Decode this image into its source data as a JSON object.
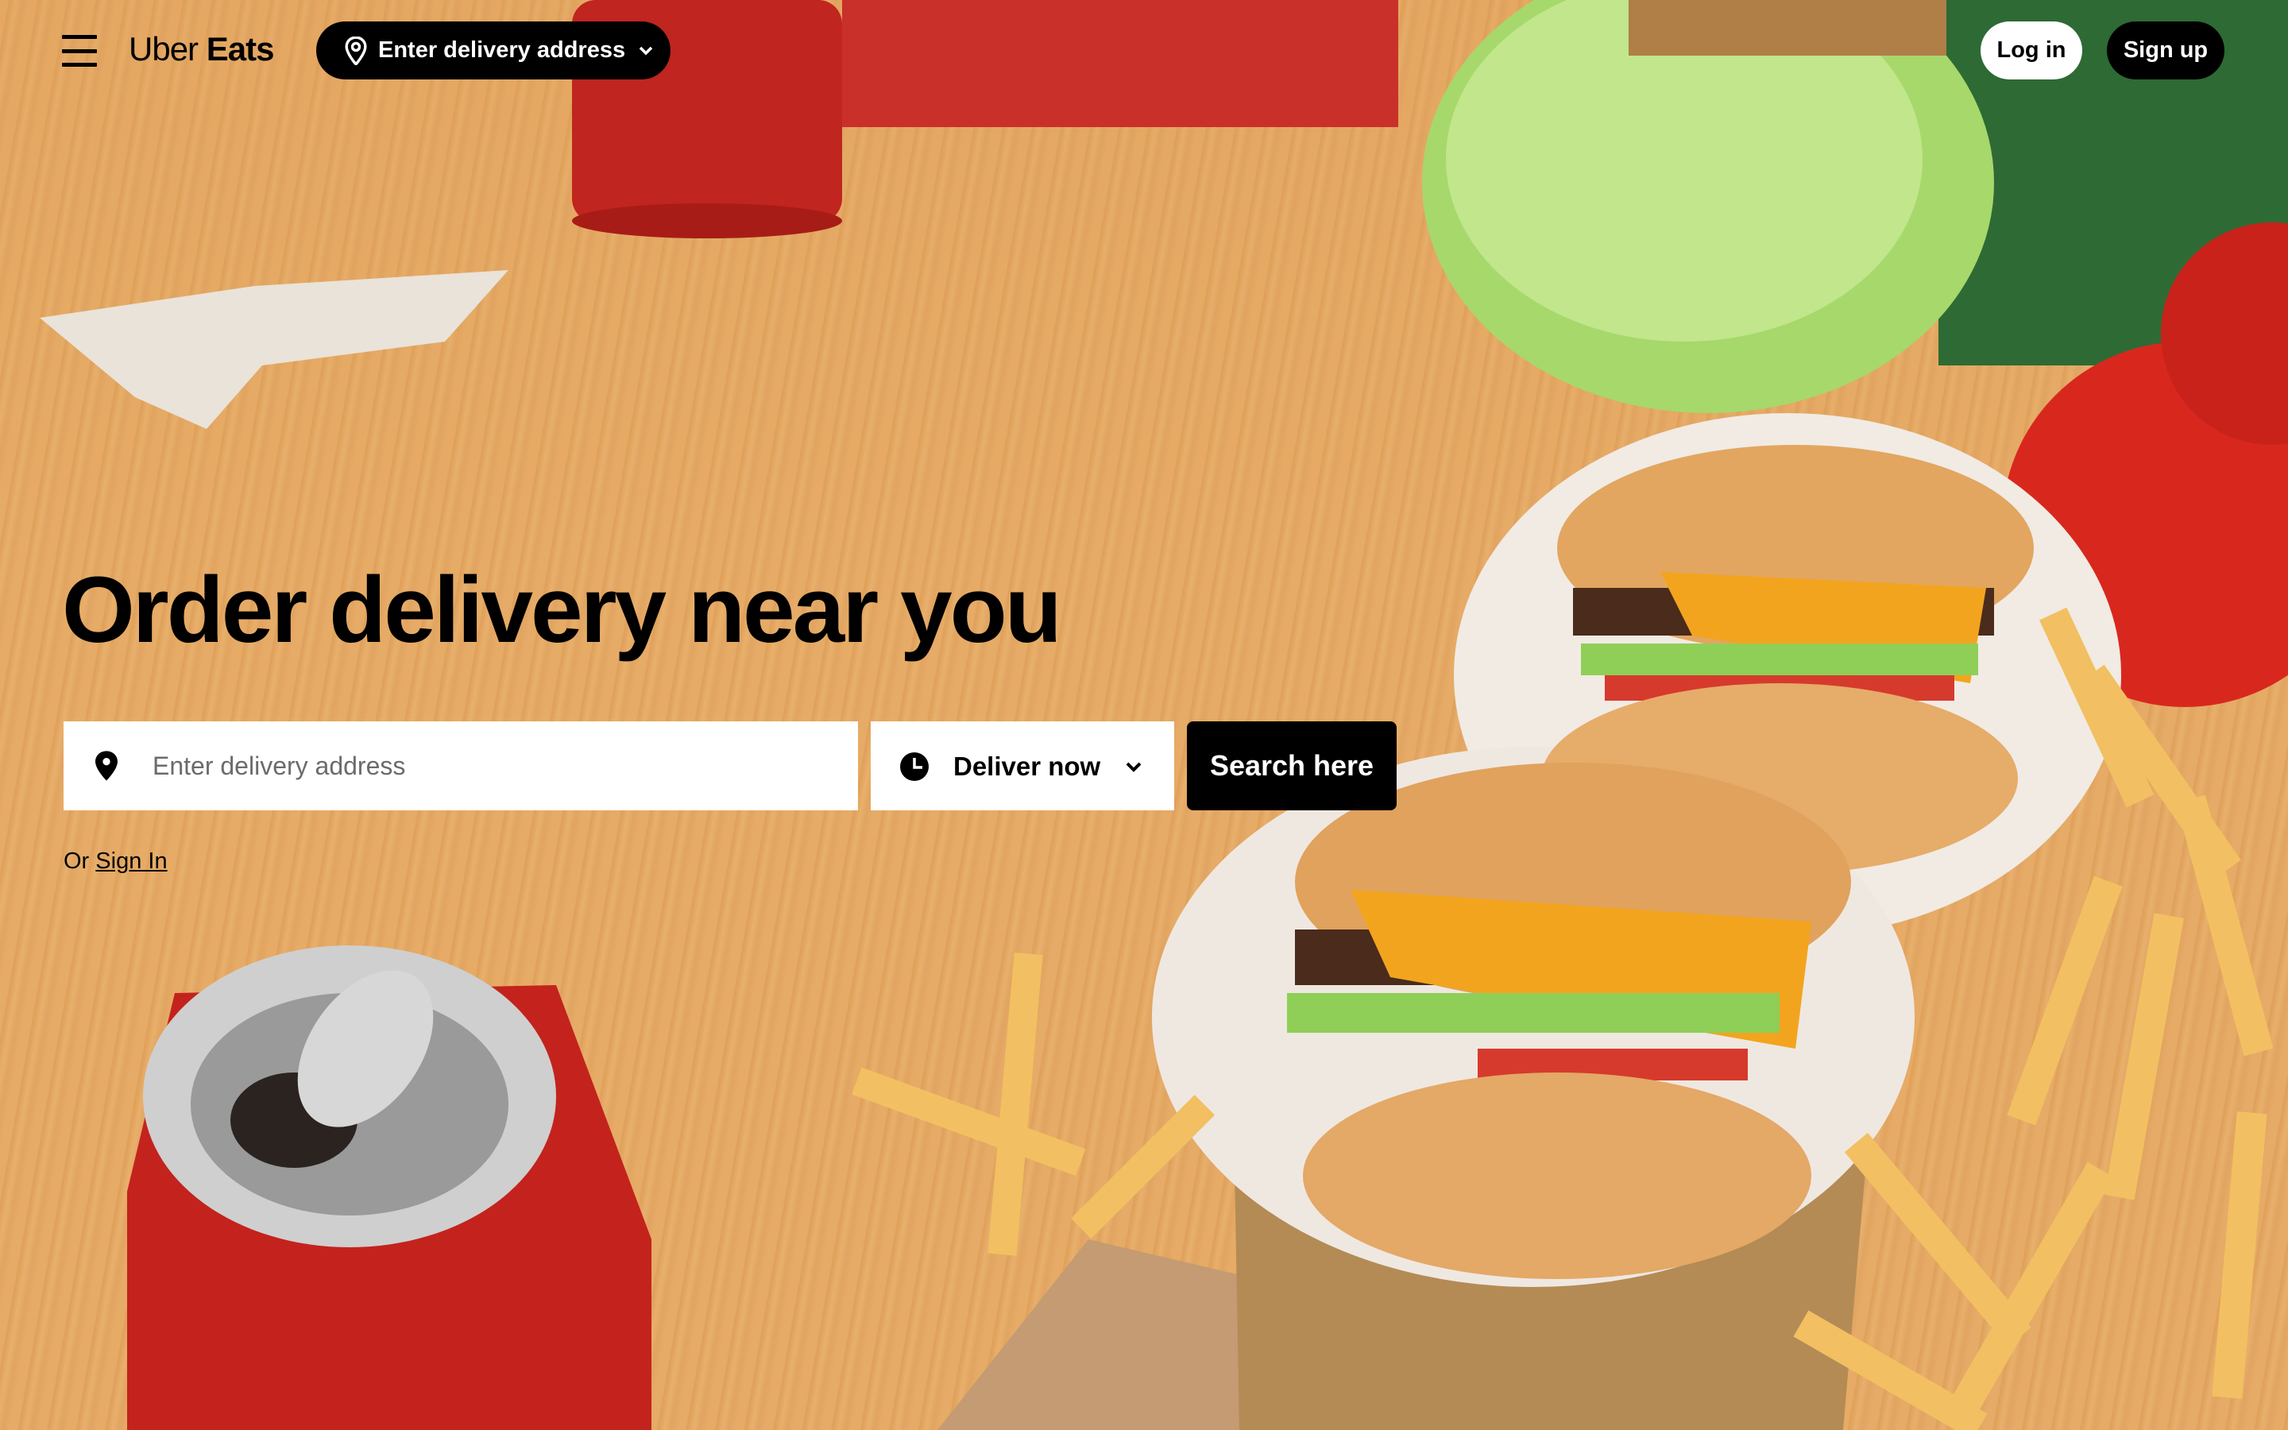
{
  "header": {
    "logo_uber": "Uber",
    "logo_eats": "Eats",
    "address_pill_label": "Enter delivery address",
    "login_label": "Log in",
    "signup_label": "Sign up"
  },
  "hero": {
    "headline": "Order delivery near you",
    "address_placeholder": "Enter delivery address",
    "time_label": "Deliver now",
    "search_label": "Search here",
    "or_text": "Or",
    "signin_link": "Sign In"
  },
  "icons": {
    "menu": "hamburger-menu-icon",
    "pin": "location-pin-icon",
    "chevron": "chevron-down-icon",
    "clock": "clock-icon"
  },
  "colors": {
    "primary": "#000000",
    "background_wood": "#e6ab66",
    "button_text": "#ffffff"
  }
}
